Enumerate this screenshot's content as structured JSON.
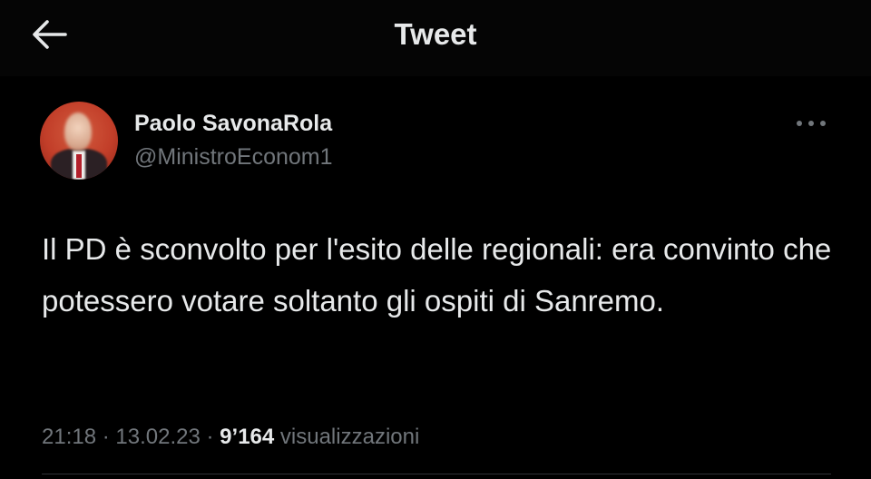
{
  "header": {
    "title": "Tweet",
    "back_icon": "arrow-left-icon"
  },
  "tweet": {
    "author_name": "Paolo SavonaRola",
    "author_handle": "@MinistroEconom1",
    "avatar_icon": "avatar-photo",
    "more_icon": "more-horizontal-icon",
    "text": "Il PD è sconvolto per l'esito delle regionali: era convinto che potessero votare soltanto gli ospiti di Sanremo.",
    "time": "21:18",
    "separator": "·",
    "date": "13.02.23",
    "views_count": "9’164",
    "views_label": "visualizzazioni"
  },
  "colors": {
    "background": "#000000",
    "primary_text": "#e7e9ea",
    "secondary_text": "#71767b",
    "divider": "#2f3336",
    "avatar_bg": "#c23e29"
  }
}
